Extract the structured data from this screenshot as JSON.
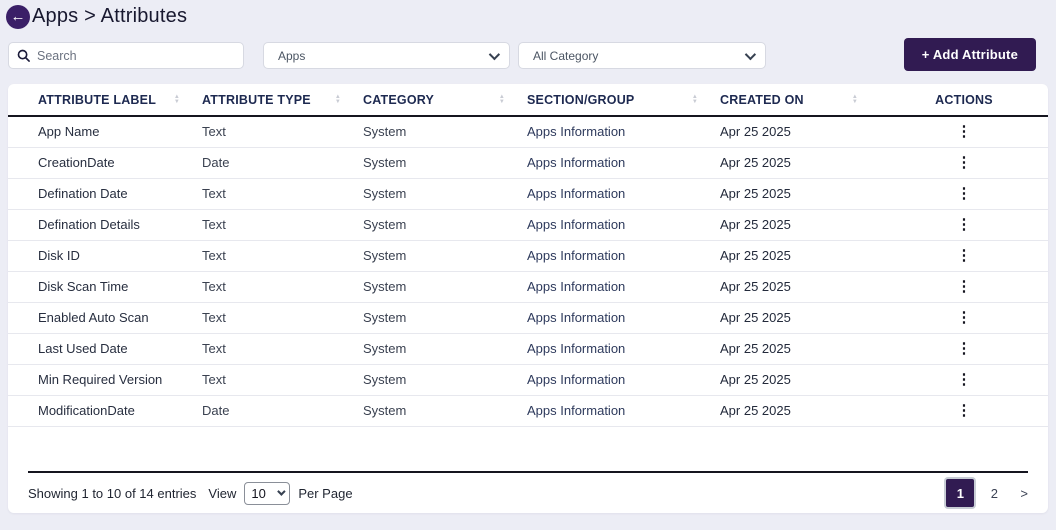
{
  "header": {
    "title": "Apps > Attributes"
  },
  "toolbar": {
    "search_placeholder": "Search",
    "app_filter_value": "Apps",
    "category_filter_value": "All Category",
    "add_button_label": "+ Add Attribute"
  },
  "table": {
    "columns": [
      {
        "label": "ATTRIBUTE LABEL",
        "sortable": true
      },
      {
        "label": "ATTRIBUTE TYPE",
        "sortable": true
      },
      {
        "label": "CATEGORY",
        "sortable": true
      },
      {
        "label": "SECTION/GROUP",
        "sortable": true
      },
      {
        "label": "CREATED ON",
        "sortable": true
      },
      {
        "label": "ACTIONS",
        "sortable": false
      }
    ],
    "rows": [
      {
        "label": "App Name",
        "type": "Text",
        "category": "System",
        "section": "Apps Information",
        "created": "Apr 25 2025"
      },
      {
        "label": "CreationDate",
        "type": "Date",
        "category": "System",
        "section": "Apps Information",
        "created": "Apr 25 2025"
      },
      {
        "label": "Defination Date",
        "type": "Text",
        "category": "System",
        "section": "Apps Information",
        "created": "Apr 25 2025"
      },
      {
        "label": "Defination Details",
        "type": "Text",
        "category": "System",
        "section": "Apps Information",
        "created": "Apr 25 2025"
      },
      {
        "label": "Disk ID",
        "type": "Text",
        "category": "System",
        "section": "Apps Information",
        "created": "Apr 25 2025"
      },
      {
        "label": "Disk Scan Time",
        "type": "Text",
        "category": "System",
        "section": "Apps Information",
        "created": "Apr 25 2025"
      },
      {
        "label": "Enabled Auto Scan",
        "type": "Text",
        "category": "System",
        "section": "Apps Information",
        "created": "Apr 25 2025"
      },
      {
        "label": "Last Used Date",
        "type": "Text",
        "category": "System",
        "section": "Apps Information",
        "created": "Apr 25 2025"
      },
      {
        "label": "Min Required Version",
        "type": "Text",
        "category": "System",
        "section": "Apps Information",
        "created": "Apr 25 2025"
      },
      {
        "label": "ModificationDate",
        "type": "Date",
        "category": "System",
        "section": "Apps Information",
        "created": "Apr 25 2025"
      }
    ],
    "actions_icon": "⋮"
  },
  "footer": {
    "showing_text": "Showing 1 to 10 of 14 entries",
    "view_label": "View",
    "per_page_value": "10",
    "per_page_label": "Per Page",
    "pagination": {
      "pages": [
        "1",
        "2"
      ],
      "active_page": "1",
      "next_label": ">"
    }
  },
  "colors": {
    "accent": "#3a1f67",
    "accent_dark": "#311b52",
    "page_background": "#ecedf5",
    "header_text": "#1d2950"
  }
}
